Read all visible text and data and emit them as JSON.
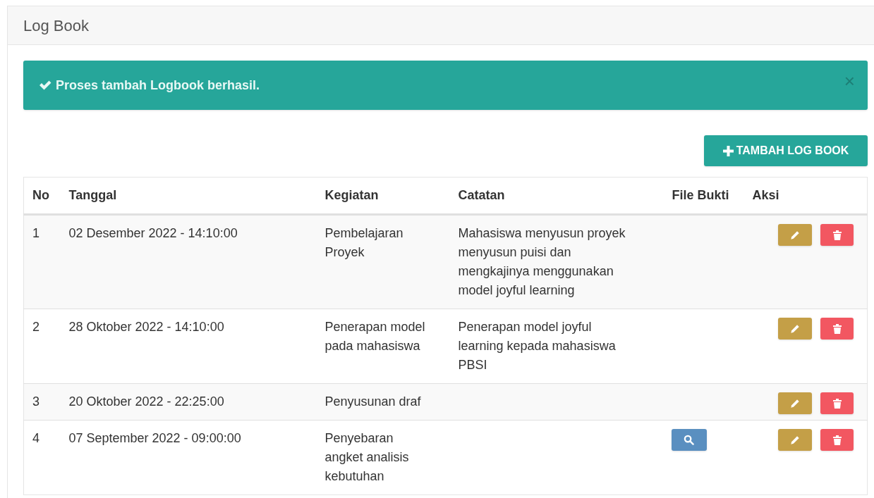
{
  "panel": {
    "title": "Log Book"
  },
  "alert": {
    "message": "Proses tambah Logbook berhasil.",
    "close": "×"
  },
  "add_button": {
    "label": "TAMBAH LOG BOOK"
  },
  "table": {
    "columns": [
      "No",
      "Tanggal",
      "Kegiatan",
      "Catatan",
      "File Bukti",
      "Aksi"
    ],
    "rows": [
      {
        "no": "1",
        "tanggal": "02 Desember 2022 - 14:10:00",
        "kegiatan": "Pembelajaran Proyek",
        "catatan": "Mahasiswa menyusun proyek menyusun puisi dan mengkajinya menggunakan model joyful learning",
        "has_file": false
      },
      {
        "no": "2",
        "tanggal": "28 Oktober 2022 - 14:10:00",
        "kegiatan": "Penerapan model pada mahasiswa",
        "catatan": "Penerapan model joyful learning kepada mahasiswa PBSI",
        "has_file": false
      },
      {
        "no": "3",
        "tanggal": "20 Oktober 2022 - 22:25:00",
        "kegiatan": "Penyusunan draf",
        "catatan": "",
        "has_file": false
      },
      {
        "no": "4",
        "tanggal": "07 September 2022 - 09:00:00",
        "kegiatan": "Penyebaran angket analisis kebutuhan",
        "catatan": "",
        "has_file": true
      }
    ]
  }
}
